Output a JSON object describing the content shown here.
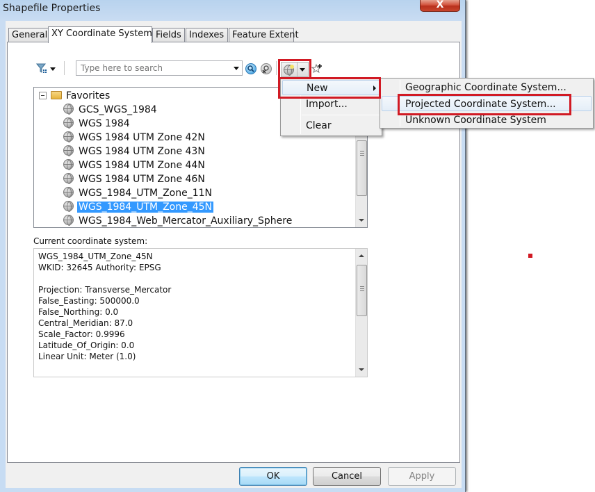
{
  "window": {
    "title": "Shapefile Properties",
    "close_label": "X"
  },
  "tabs": [
    {
      "label": "General",
      "active": false
    },
    {
      "label": "XY Coordinate System",
      "active": true
    },
    {
      "label": "Fields",
      "active": false
    },
    {
      "label": "Indexes",
      "active": false
    },
    {
      "label": "Feature Extent",
      "active": false
    }
  ],
  "toolbar": {
    "filter_icon": "filter-icon",
    "search_placeholder": "Type here to search",
    "search_value": "",
    "search_icon": "search-icon",
    "clear_search_icon": "clear-search-icon",
    "add_coordinate_system_icon": "globe-add-icon",
    "add_favorite_icon": "star-add-icon"
  },
  "tree": {
    "root": {
      "label": "Favorites",
      "expanded": true,
      "icon": "folder-icon"
    },
    "items": [
      {
        "label": "GCS_WGS_1984",
        "selected": false
      },
      {
        "label": "WGS 1984",
        "selected": false
      },
      {
        "label": "WGS 1984 UTM Zone 42N",
        "selected": false
      },
      {
        "label": "WGS 1984 UTM Zone 43N",
        "selected": false
      },
      {
        "label": "WGS 1984 UTM Zone 44N",
        "selected": false
      },
      {
        "label": "WGS 1984 UTM Zone 46N",
        "selected": false
      },
      {
        "label": "WGS_1984_UTM_Zone_11N",
        "selected": false
      },
      {
        "label": "WGS_1984_UTM_Zone_45N",
        "selected": true
      },
      {
        "label": "WGS_1984_Web_Mercator_Auxiliary_Sphere",
        "selected": false
      }
    ]
  },
  "current_cs": {
    "label": "Current coordinate system:",
    "lines": [
      "WGS_1984_UTM_Zone_45N",
      "WKID: 32645 Authority: EPSG",
      "",
      "Projection: Transverse_Mercator",
      "False_Easting: 500000.0",
      "False_Northing: 0.0",
      "Central_Meridian: 87.0",
      "Scale_Factor: 0.9996",
      "Latitude_Of_Origin: 0.0",
      "Linear Unit: Meter (1.0)"
    ]
  },
  "dropdown_menu": {
    "items": [
      {
        "label": "New",
        "has_submenu": true,
        "highlighted": true
      },
      {
        "label": "Import...",
        "has_submenu": false
      },
      {
        "label": "Clear",
        "has_submenu": false
      }
    ]
  },
  "submenu": {
    "items": [
      {
        "label": "Geographic Coordinate System...",
        "highlighted": false
      },
      {
        "label": "Projected Coordinate System...",
        "highlighted": true
      },
      {
        "label": "Unknown Coordinate System",
        "highlighted": false
      }
    ]
  },
  "buttons": {
    "ok": "OK",
    "cancel": "Cancel",
    "apply": "Apply"
  },
  "colors": {
    "highlight_red": "#d11a24",
    "selection_blue": "#3399ff"
  }
}
